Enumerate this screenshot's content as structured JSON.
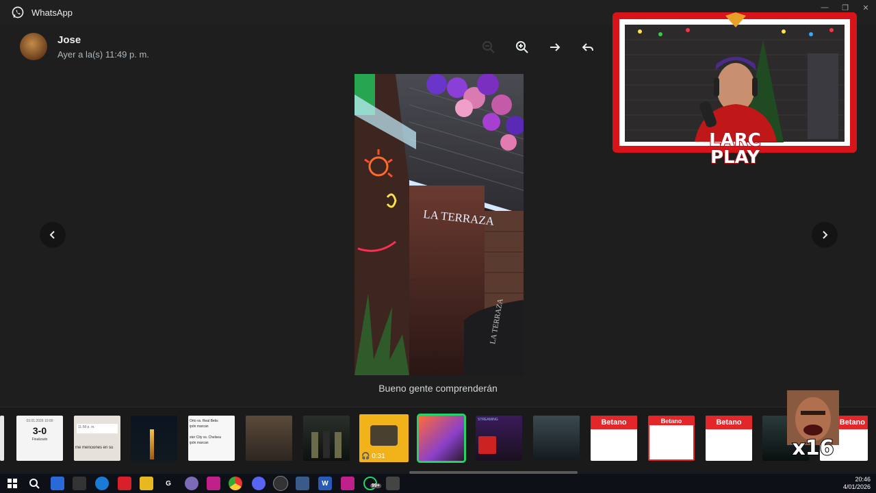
{
  "window": {
    "title": "WhatsApp"
  },
  "header": {
    "contact_name": "Jose",
    "timestamp": "Ayer a la(s) 11:49 p. m."
  },
  "viewer": {
    "sign_text": "LA TERRAZA",
    "sign_text2": "LA TERRAZA",
    "caption": "Bueno gente comprenderán"
  },
  "thumbnails": [
    {
      "kind": "score",
      "date": "03.01.2026 10:00",
      "score": "3-0",
      "status": "Finalizado"
    },
    {
      "kind": "chat",
      "time": "11:58 p. m.",
      "text": "me menciones en su"
    },
    {
      "kind": "night-photo"
    },
    {
      "kind": "text-list",
      "line1": "Orto vs. Real Betis",
      "line2": "ipón marcan",
      "line3": "ster City vs. Chelsea",
      "line4": "ipón marcan"
    },
    {
      "kind": "wallet"
    },
    {
      "kind": "soldiers"
    },
    {
      "kind": "video",
      "duration": "0:31"
    },
    {
      "kind": "selected-photo"
    },
    {
      "kind": "stream",
      "label": "STREAMING"
    },
    {
      "kind": "soldiers2"
    },
    {
      "kind": "betano",
      "brand": "Betano"
    },
    {
      "kind": "betano",
      "brand": "Betano"
    },
    {
      "kind": "betano",
      "brand": "Betano"
    },
    {
      "kind": "team"
    },
    {
      "kind": "betano",
      "brand": "Betano"
    }
  ],
  "overlay": {
    "webcam_brand_line1": "LARC",
    "webcam_brand_line2": "PLAY",
    "sticker_text": "x16"
  },
  "taskbar": {
    "whatsapp_badge": "99+",
    "time": "20:46",
    "date": "4/01/2026"
  },
  "colors": {
    "accent_green": "#25d366",
    "background": "#1e1e1e",
    "betano_red": "#e3262a"
  }
}
